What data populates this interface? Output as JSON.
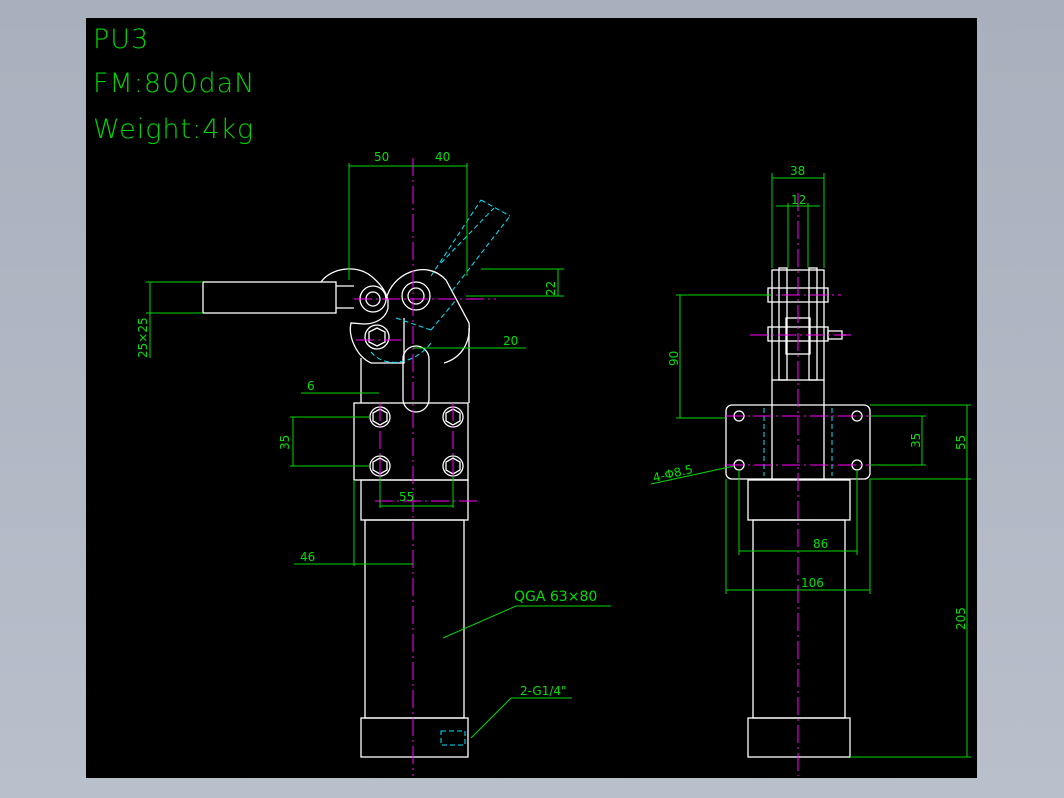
{
  "title_block": {
    "model": "PU3",
    "force": "FM:800daN",
    "weight": "Weight:4kg"
  },
  "dimensions": {
    "d50": "50",
    "d40": "40",
    "d22": "22",
    "d25x25": "25×25",
    "d20": "20",
    "d6": "6",
    "d35_left": "35",
    "d55_left": "55",
    "d46": "46",
    "d38": "38",
    "d12": "12",
    "d90": "90",
    "d35_right": "35",
    "d55_right": "55",
    "d86": "86",
    "d106": "106",
    "d205": "205"
  },
  "callouts": {
    "cylinder": "QGA 63×80",
    "port": "2-G1/4\"",
    "holes": "4-Φ8.5"
  },
  "colors": {
    "background": "#000000",
    "outline": "#ffffff",
    "dimension": "#00d800",
    "centerline": "#ff00ff",
    "hidden": "#00e5ff"
  }
}
